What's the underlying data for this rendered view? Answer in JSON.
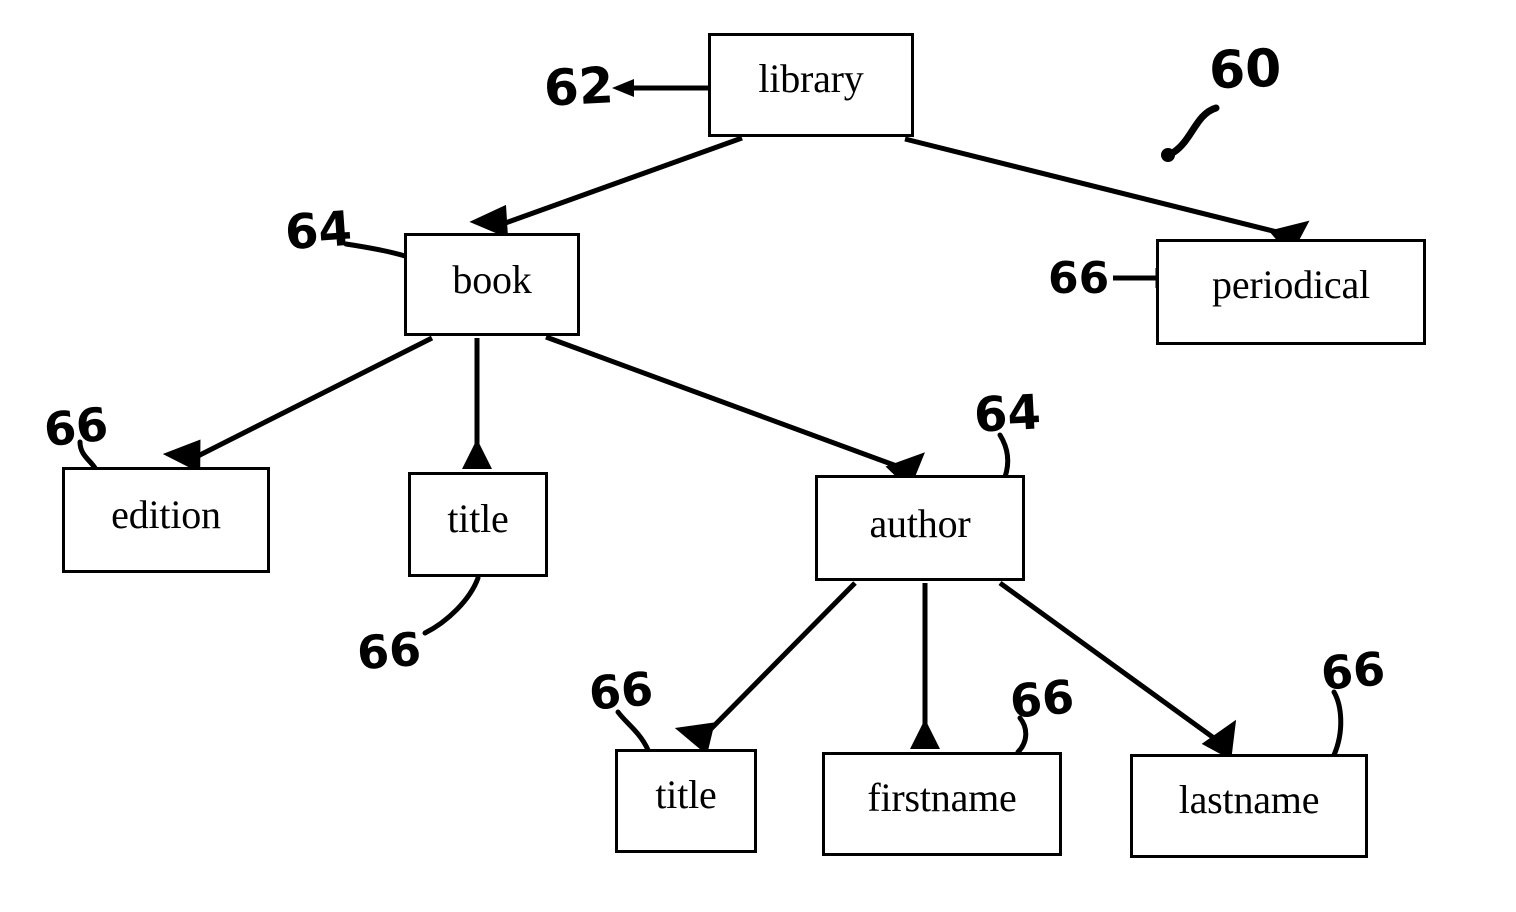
{
  "figure": {
    "kind": "patent-figure-tree-diagram",
    "overall_reference": "60",
    "ink_color": "#000000",
    "background_color": "#ffffff"
  },
  "nodes": [
    {
      "id": "library",
      "label": "library",
      "reference": "62",
      "level": 0
    },
    {
      "id": "book",
      "label": "book",
      "reference": "64",
      "level": 1
    },
    {
      "id": "periodical",
      "label": "periodical",
      "reference": "66",
      "level": 1
    },
    {
      "id": "edition",
      "label": "edition",
      "reference": "66",
      "level": 2
    },
    {
      "id": "title-book",
      "label": "title",
      "reference": "66",
      "level": 2
    },
    {
      "id": "author",
      "label": "author",
      "reference": "64",
      "level": 2
    },
    {
      "id": "title-author",
      "label": "title",
      "reference": "66",
      "level": 3
    },
    {
      "id": "firstname",
      "label": "firstname",
      "reference": "66",
      "level": 3
    },
    {
      "id": "lastname",
      "label": "lastname",
      "reference": "66",
      "level": 3
    }
  ],
  "edges": [
    {
      "from": "library",
      "to": "book"
    },
    {
      "from": "library",
      "to": "periodical"
    },
    {
      "from": "book",
      "to": "edition"
    },
    {
      "from": "book",
      "to": "title-book"
    },
    {
      "from": "book",
      "to": "author"
    },
    {
      "from": "author",
      "to": "title-author"
    },
    {
      "from": "author",
      "to": "firstname"
    },
    {
      "from": "author",
      "to": "lastname"
    }
  ],
  "reference_numerals": {
    "overall": "60",
    "root": "62",
    "element": "64",
    "attribute": "66"
  },
  "labels": {
    "library": "library",
    "book": "book",
    "periodical": "periodical",
    "edition": "edition",
    "title_book": "title",
    "author": "author",
    "title_author": "title",
    "firstname": "firstname",
    "lastname": "lastname",
    "ref_60": "60",
    "ref_62": "62",
    "ref_64_book": "64",
    "ref_66_periodical": "66",
    "ref_66_edition": "66",
    "ref_66_title_book": "66",
    "ref_64_author": "64",
    "ref_66_title_author": "66",
    "ref_66_firstname": "66",
    "ref_66_lastname": "66"
  }
}
